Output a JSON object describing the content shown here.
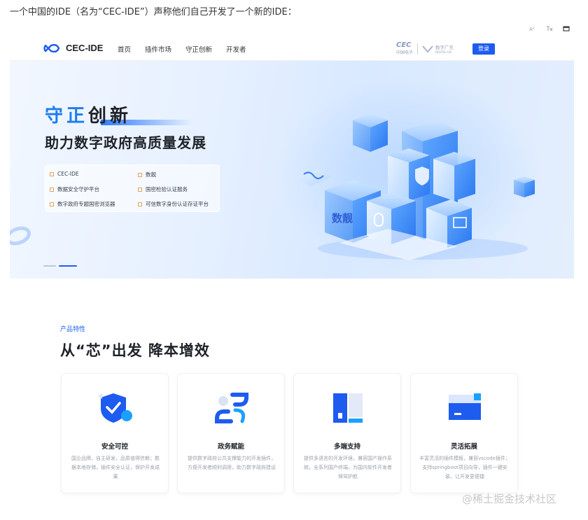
{
  "post": {
    "text": "一个中国的IDE（名为“CEC-IDE”）声称他们自己开发了一个新的IDE："
  },
  "toolbar": {
    "icons": [
      "text-size-icon",
      "translate-icon",
      "fullscreen-icon"
    ]
  },
  "nav": {
    "brand": "CEC-IDE",
    "links": [
      "首页",
      "插件市场",
      "守正创新",
      "开发者"
    ],
    "partner": {
      "cec": "CEC",
      "cec_sub": "中国电子",
      "second": "数字广东",
      "second_sub": "DIGITAL GD"
    },
    "login": "登录"
  },
  "hero": {
    "title_blue": "守正",
    "title_dark": "创新",
    "subtitle": "助力数字政府高质量发展",
    "features": [
      "CEC-IDE",
      "数靓",
      "数据安全守护平台",
      "国密检验认证服务",
      "数字政府专题国密浏览器",
      "可信数字身份认证存证平台"
    ],
    "cube_label": "数靓"
  },
  "section": {
    "tag": "产品特性",
    "title": "从“芯”出发 降本增效",
    "cards": [
      {
        "title": "安全可控",
        "desc": "国企品牌，自主研发，品质值得信赖；数据本地存储，插件安全认证，保护开发成果"
      },
      {
        "title": "政务赋能",
        "desc": "提供数字政府公共支撑能力的开发插件，方便开发者顺利调用，助力数字政府建设"
      },
      {
        "title": "多端支持",
        "desc": "提供多语言的开发环境，兼容国产操作系统，全系列国产终端，为国内软件开发者保驾护航"
      },
      {
        "title": "灵活拓展",
        "desc": "丰富灵活的插件模板，兼容vscode插件；支持springboot项目向导，插件一键安装，让开发更便捷"
      }
    ]
  },
  "watermark": "@稀土掘金技术社区",
  "colors": {
    "brand": "#1e5cf0",
    "accent": "#1a7cf0",
    "text": "#1f2329"
  }
}
